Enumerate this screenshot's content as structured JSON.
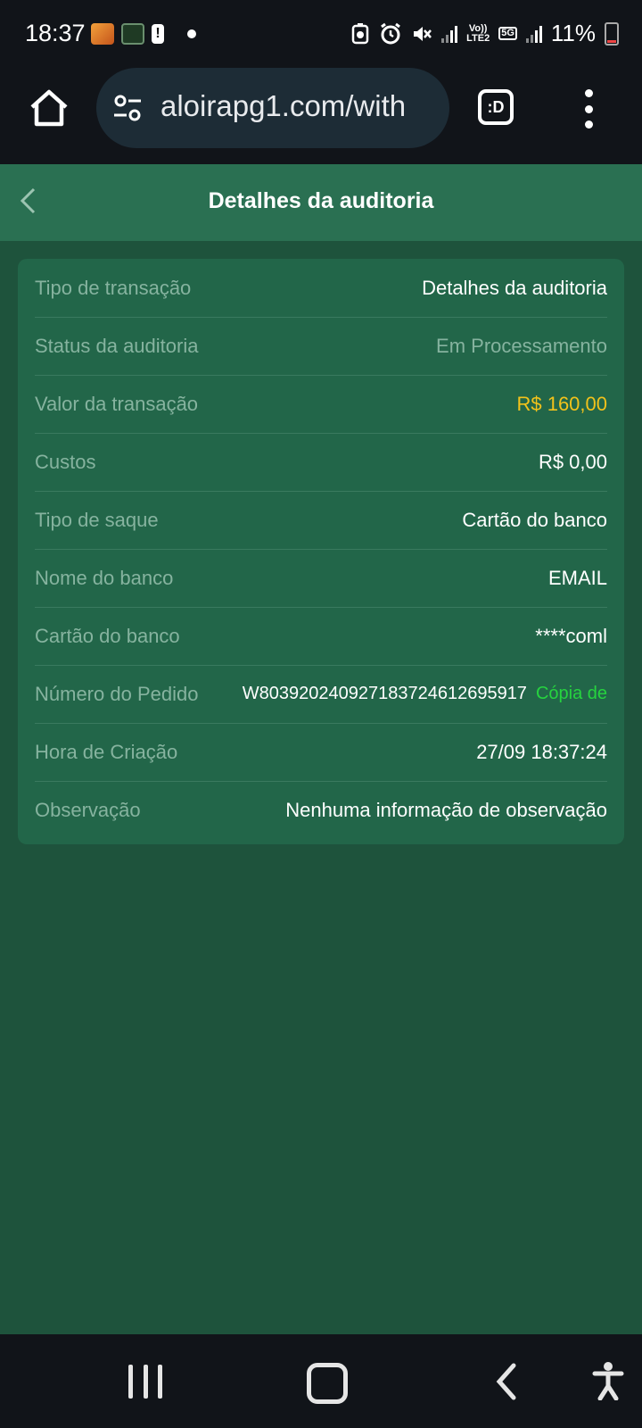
{
  "status_bar": {
    "time": "18:37",
    "network_label": "Vo))\nLTE2",
    "fiveg_label": "5G",
    "battery": "11%"
  },
  "browser": {
    "url": "aloirapg1.com/with",
    "tab_icon_label": ":D"
  },
  "header": {
    "title": "Detalhes da auditoria"
  },
  "details": {
    "rows": [
      {
        "label": "Tipo de transação",
        "value": "Detalhes da auditoria"
      },
      {
        "label": "Status da auditoria",
        "value": "Em Processamento"
      },
      {
        "label": "Valor da transação",
        "value": "R$ 160,00"
      },
      {
        "label": "Custos",
        "value": "R$ 0,00"
      },
      {
        "label": "Tipo de saque",
        "value": "Cartão do banco"
      },
      {
        "label": "Nome do banco",
        "value": "EMAIL"
      },
      {
        "label": "Cartão do banco",
        "value": "****coml"
      },
      {
        "label": "Número do Pedido",
        "value": "W80392024092718372461269591​7",
        "action": "Cópia de"
      },
      {
        "label": "Hora de Criação",
        "value": "27/09 18:37:24"
      },
      {
        "label": "Observação",
        "value": "Nenhuma informação de observação"
      }
    ]
  },
  "colors": {
    "page_bg": "#1e533c",
    "header_bg": "#2a7052",
    "card_bg": "#226649",
    "label": "#86b39f",
    "amount": "#f2c21b",
    "copy_link": "#26d33f"
  },
  "icons": {
    "browser_home": "home-icon",
    "site_settings": "tune-icon",
    "tab_switcher": "tab-switcher-icon",
    "menu": "more-vert-icon",
    "back": "chevron-left-icon",
    "nav_recents": "recents-icon",
    "nav_home": "home-circle-icon",
    "nav_back": "back-arrow-icon",
    "accessibility": "accessibility-icon"
  }
}
